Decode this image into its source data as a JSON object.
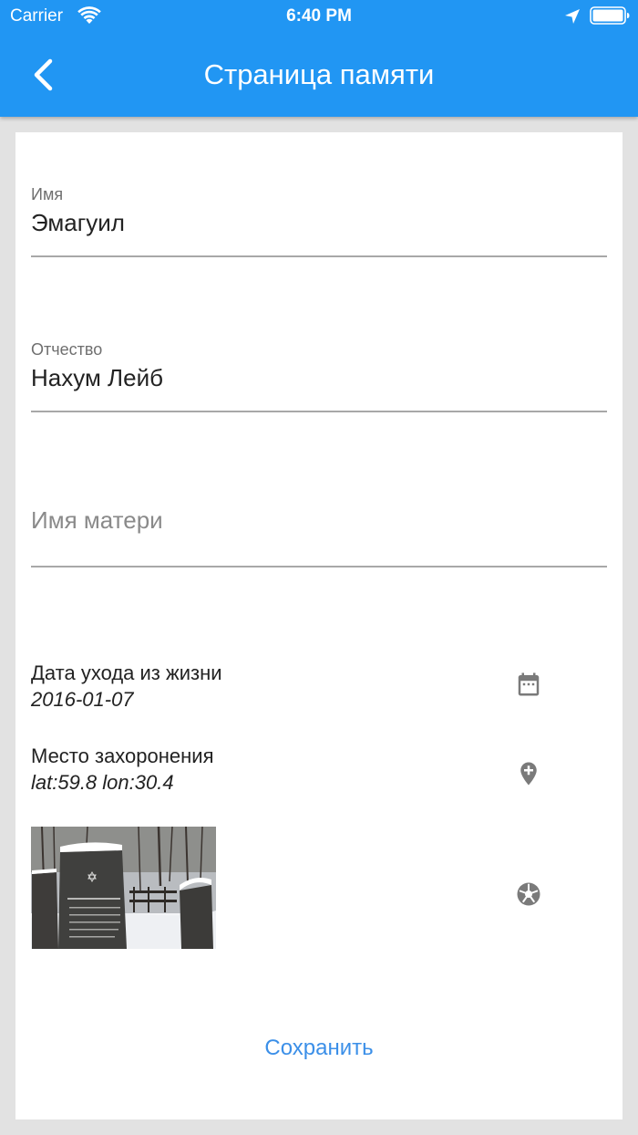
{
  "status_bar": {
    "carrier": "Carrier",
    "time": "6:40 PM"
  },
  "header": {
    "title": "Страница памяти",
    "background": "#2196f3"
  },
  "form": {
    "first_name": {
      "label": "Имя",
      "value": "Эмагуил"
    },
    "patronymic": {
      "label": "Отчество",
      "value": "Нахум Лейб"
    },
    "mother_name": {
      "placeholder": "Имя матери",
      "value": ""
    },
    "death_date": {
      "label": "Дата ухода из жизни",
      "value": "2016-01-07",
      "icon": "calendar-icon"
    },
    "burial_place": {
      "label": "Место захоронения",
      "value": "lat:59.8 lon:30.4",
      "icon": "add-location-icon"
    },
    "photo": {
      "icon": "camera-shutter-icon"
    }
  },
  "actions": {
    "save_label": "Сохранить",
    "accent": "#3b8fe8"
  }
}
